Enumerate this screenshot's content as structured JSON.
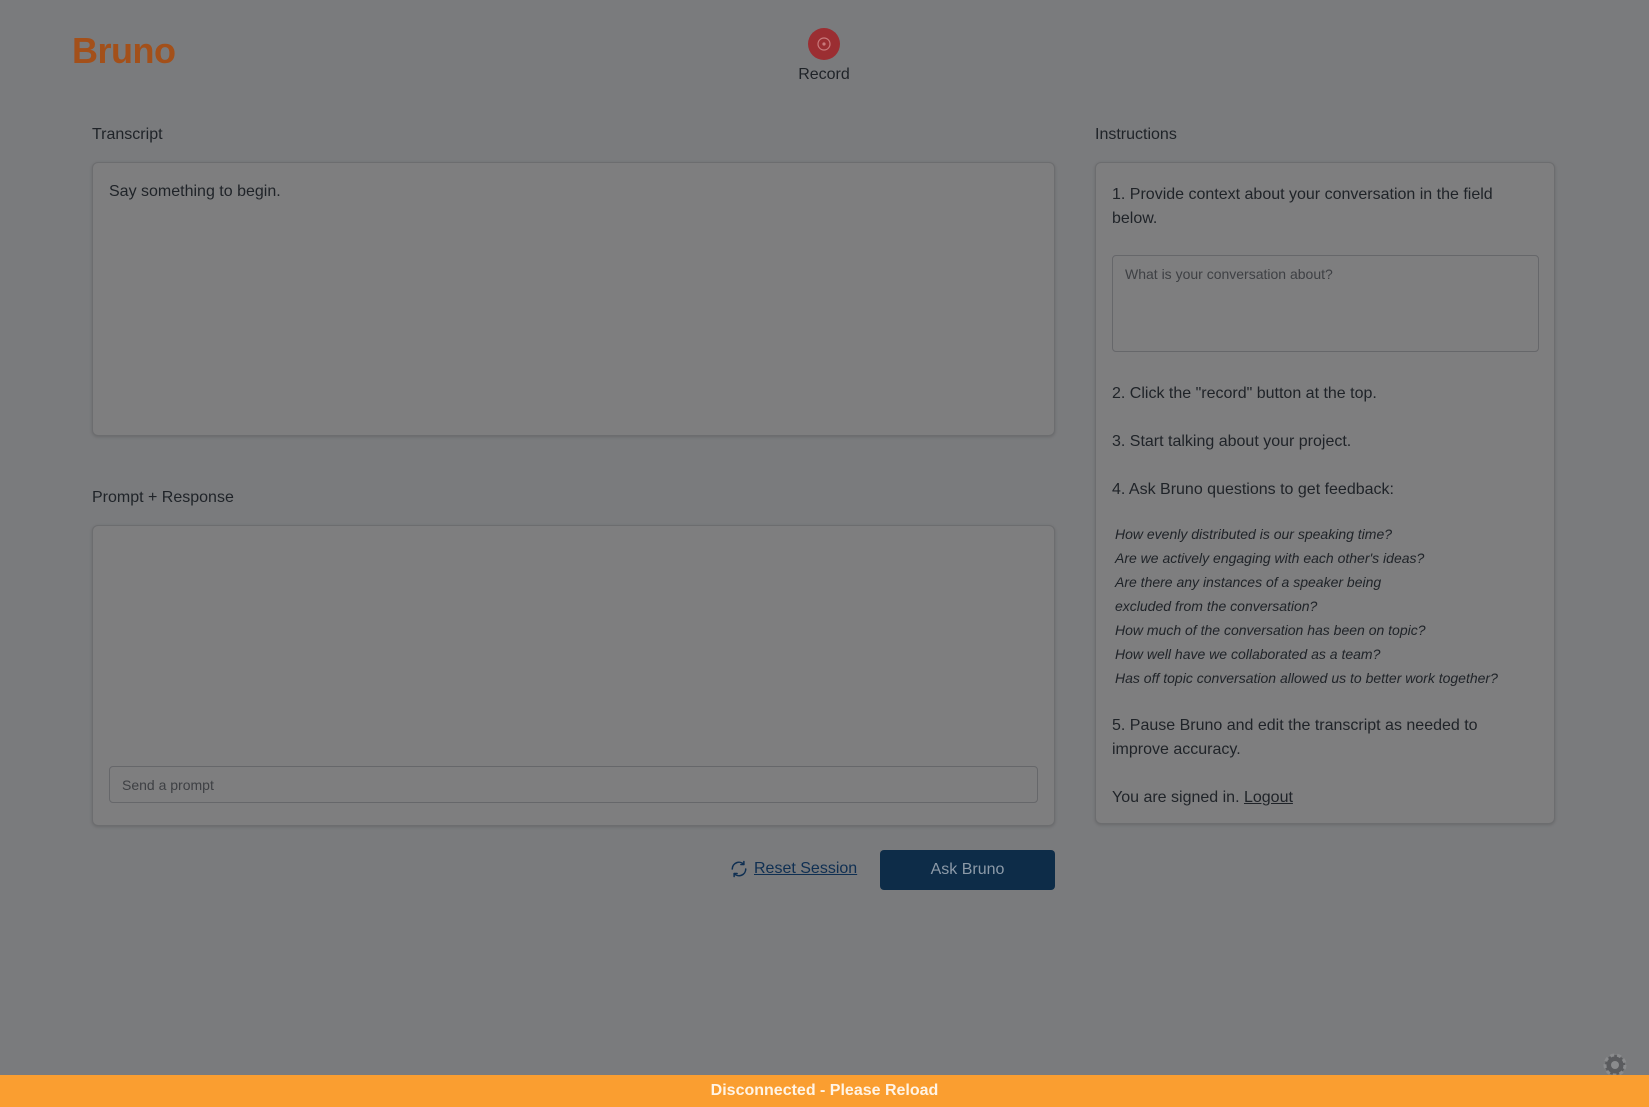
{
  "app": {
    "title": "Bruno"
  },
  "record": {
    "label": "Record"
  },
  "transcript": {
    "heading": "Transcript",
    "text": "Say something to begin."
  },
  "prompt_response": {
    "heading": "Prompt + Response",
    "input_placeholder": "Send a prompt"
  },
  "instructions": {
    "heading": "Instructions",
    "step1": "1. Provide context about your conversation in the field below.",
    "context_placeholder": "What is your conversation about?",
    "step2": "2. Click the \"record\" button at the top.",
    "step3": "3. Start talking about your project.",
    "step4": "4. Ask Bruno questions to get feedback:",
    "examples": [
      "How evenly distributed is our speaking time?",
      "Are we actively engaging with each other's ideas?",
      "Are there any instances of a speaker being",
      "excluded from the conversation?",
      "How much of the conversation has been on topic?",
      "How well have we collaborated as a team?",
      "Has off topic conversation allowed us to better work together?"
    ],
    "step5": "5. Pause Bruno and edit the transcript as needed to improve accuracy.",
    "signed_in_text": "You are signed in.",
    "logout_label": "Logout"
  },
  "actions": {
    "reset_label": "Reset Session",
    "ask_label": "Ask Bruno"
  },
  "footer": {
    "status": "Disconnected - Please Reload"
  },
  "colors": {
    "background": "#7a7b7d",
    "logo": "#a3501a",
    "record": "#9b2e32",
    "ask_button": "#0d2c48",
    "footer": "#fa9e30"
  }
}
